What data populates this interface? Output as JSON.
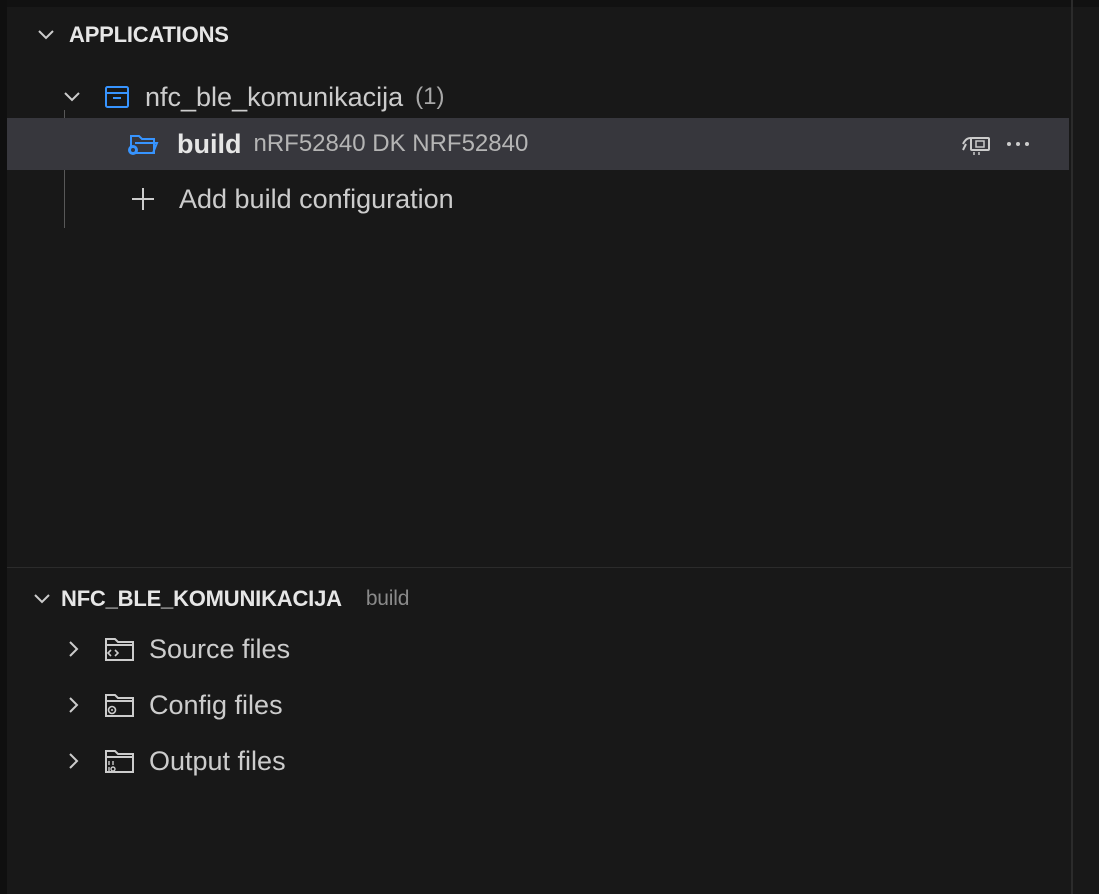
{
  "applications": {
    "header": "APPLICATIONS",
    "app": {
      "name": "nfc_ble_komunikacija",
      "count": "(1)"
    },
    "build": {
      "label": "build",
      "description": "nRF52840 DK NRF52840"
    },
    "add_build": "Add build configuration"
  },
  "project": {
    "header": "NFC_BLE_KOMUNIKACIJA",
    "header_desc": "build",
    "items": [
      {
        "label": "Source files",
        "icon": "source-folder-icon"
      },
      {
        "label": "Config files",
        "icon": "config-folder-icon"
      },
      {
        "label": "Output files",
        "icon": "output-folder-icon"
      }
    ]
  },
  "colors": {
    "background": "#181818",
    "selected": "#37373d",
    "accent": "#3794ff"
  }
}
